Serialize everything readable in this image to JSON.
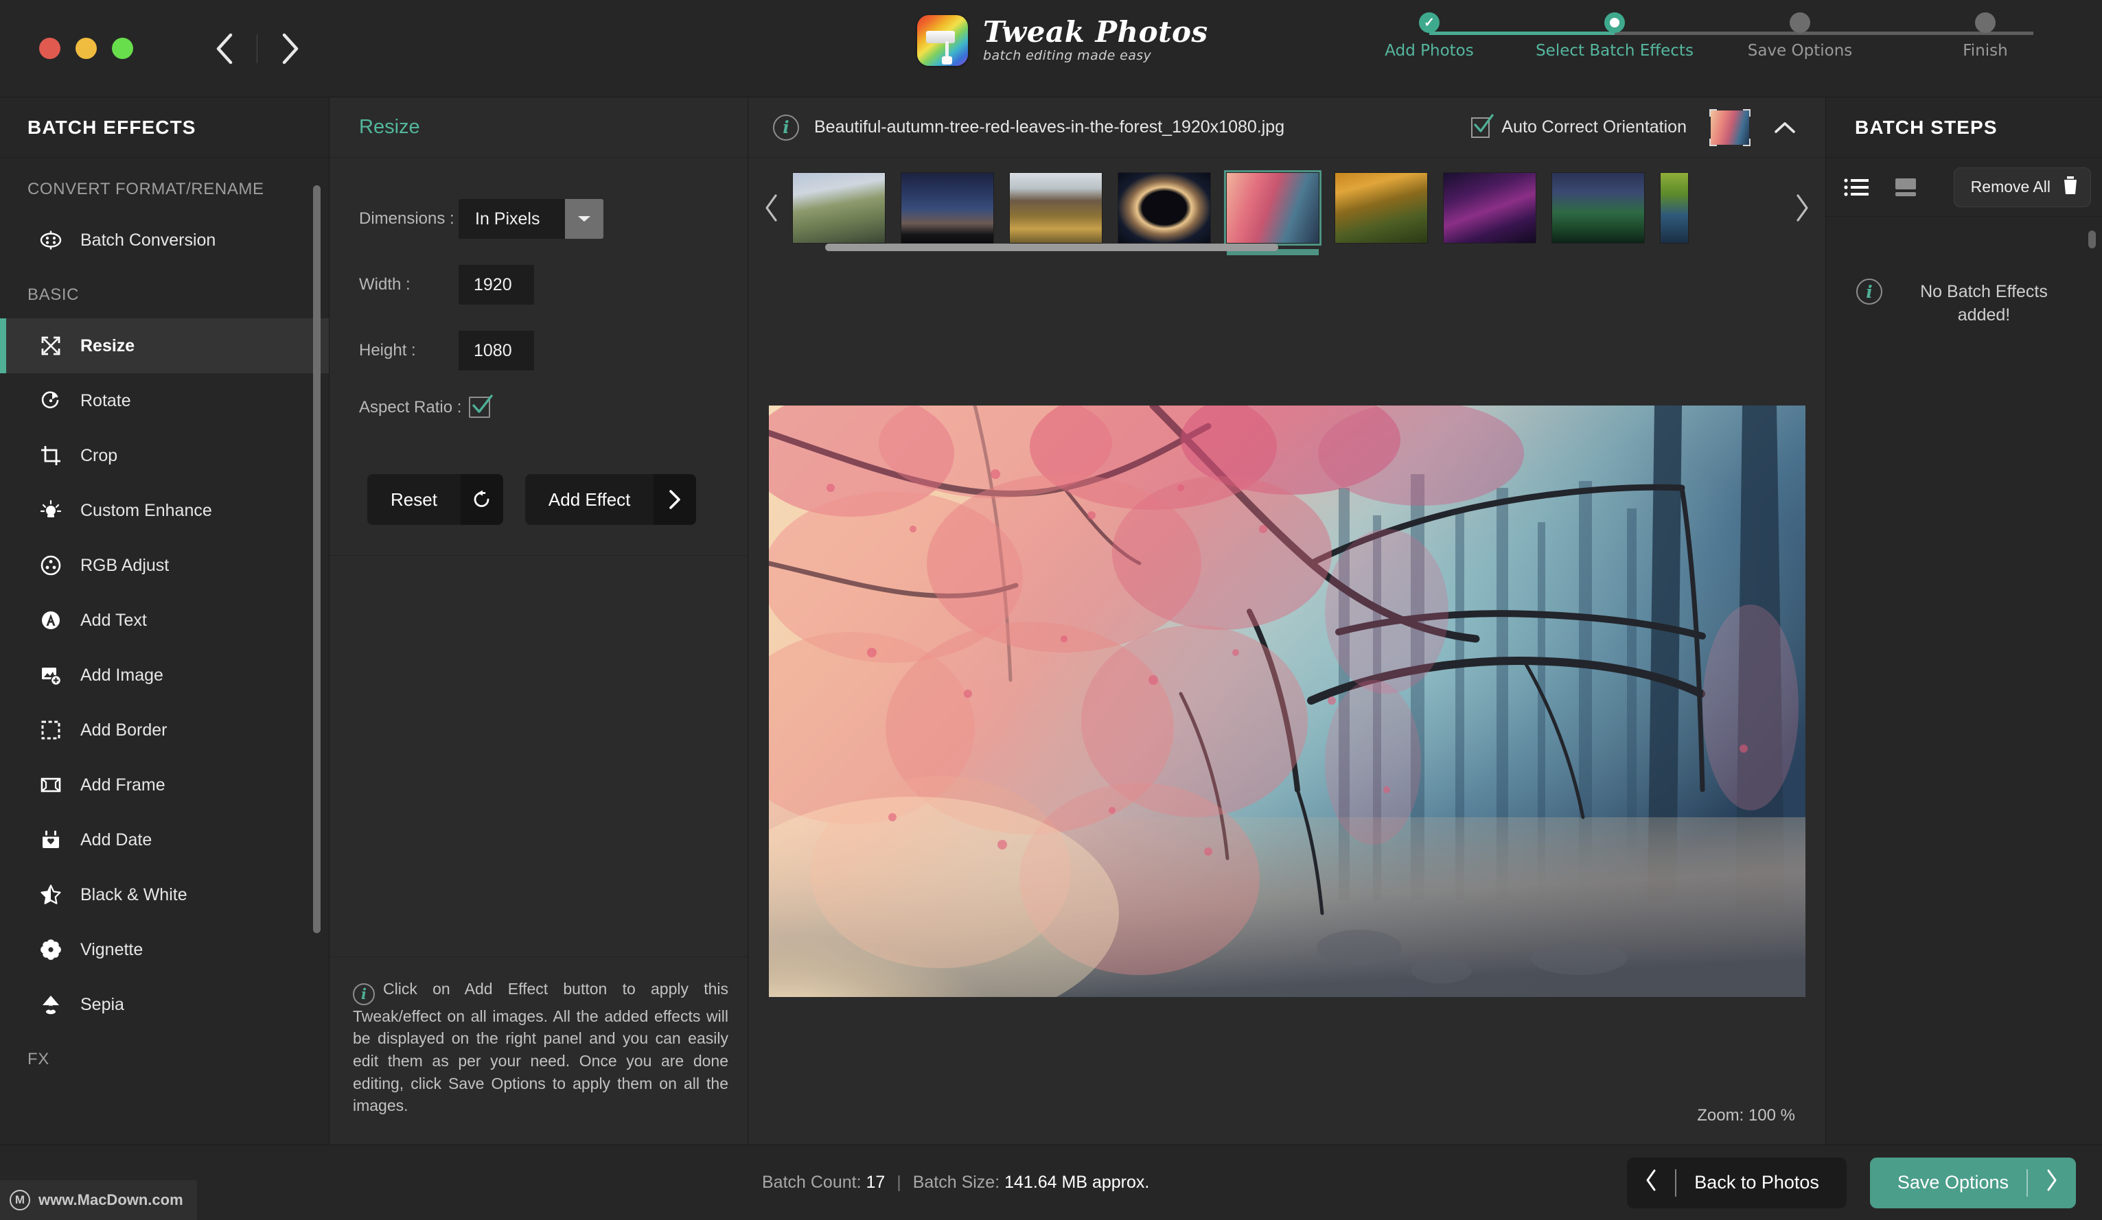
{
  "window": {
    "traffic_lights": [
      "close",
      "minimize",
      "maximize"
    ],
    "nav_back": "back-arrow",
    "nav_forward": "forward-arrow"
  },
  "brand": {
    "title": "Tweak Photos",
    "tagline": "batch editing made easy",
    "logo": "paint-roller-icon"
  },
  "stepper": {
    "steps": [
      {
        "label": "Add Photos",
        "state": "done"
      },
      {
        "label": "Select Batch Effects",
        "state": "current"
      },
      {
        "label": "Save Options",
        "state": "pending"
      },
      {
        "label": "Finish",
        "state": "pending"
      }
    ]
  },
  "sidebar": {
    "title": "BATCH EFFECTS",
    "groups": [
      {
        "label": "CONVERT FORMAT/RENAME",
        "items": [
          {
            "label": "Batch Conversion",
            "icon": "batch-conversion-icon",
            "active": false
          }
        ]
      },
      {
        "label": "BASIC",
        "items": [
          {
            "label": "Resize",
            "icon": "resize-icon",
            "active": true
          },
          {
            "label": "Rotate",
            "icon": "rotate-icon",
            "active": false
          },
          {
            "label": "Crop",
            "icon": "crop-icon",
            "active": false
          },
          {
            "label": "Custom Enhance",
            "icon": "lightbulb-icon",
            "active": false
          },
          {
            "label": "RGB Adjust",
            "icon": "rgb-adjust-icon",
            "active": false
          },
          {
            "label": "Add Text",
            "icon": "add-text-icon",
            "active": false
          },
          {
            "label": "Add Image",
            "icon": "add-image-icon",
            "active": false
          },
          {
            "label": "Add Border",
            "icon": "add-border-icon",
            "active": false
          },
          {
            "label": "Add Frame",
            "icon": "add-frame-icon",
            "active": false
          },
          {
            "label": "Add Date",
            "icon": "calendar-icon",
            "active": false
          },
          {
            "label": "Black & White",
            "icon": "star-half-icon",
            "active": false
          },
          {
            "label": "Vignette",
            "icon": "flower-icon",
            "active": false
          },
          {
            "label": "Sepia",
            "icon": "lamp-icon",
            "active": false
          }
        ]
      },
      {
        "label": "FX",
        "items": []
      }
    ]
  },
  "effect_panel": {
    "title": "Resize",
    "fields": {
      "dimensions_label": "Dimensions :",
      "dimensions_value": "In Pixels",
      "width_label": "Width :",
      "width_value": "1920",
      "height_label": "Height :",
      "height_value": "1080",
      "aspect_label": "Aspect Ratio :",
      "aspect_checked": true
    },
    "reset_label": "Reset",
    "add_effect_label": "Add Effect",
    "note": "Click on Add Effect button to apply this Tweak/effect on all images. All the added effects will be displayed on the right panel and you can easily edit them as per your need. Once you are done editing, click Save Options to apply them on all the images."
  },
  "main": {
    "filename": "Beautiful-autumn-tree-red-leaves-in-the-forest_1920x1080.jpg",
    "auto_correct_label": "Auto Correct Orientation",
    "auto_correct_checked": true,
    "collapse_icon": "chevron-up-icon",
    "zoom_label": "Zoom: 100 %",
    "filmstrip": {
      "prev_icon": "chevron-left-icon",
      "next_icon": "chevron-right-icon",
      "selected_index": 4,
      "thumbs": [
        {
          "name": "thumb-sunset-tree",
          "grad": "linear-gradient(170deg,#b9c6d8 0%,#cfd6de 26%,#8d9a6d 46%,#6f7f54 66%,#515f43 86%,#3b4533 100%)"
        },
        {
          "name": "thumb-night-sky",
          "grad": "linear-gradient(180deg,#1c2340 0%,#2b3b66 32%,#3a4d7a 52%,#6b5a55 72%,#161618 88%,#0c0c10 100%)"
        },
        {
          "name": "thumb-canyon-aspen",
          "grad": "linear-gradient(180deg,#d8dde2 0%,#b9c2c6 22%,#6d5a46 40%,#8d7336 62%,#c7a04a 80%,#6f5e2d 100%)"
        },
        {
          "name": "thumb-eclipse",
          "grad": "radial-gradient(ellipse at 50% 50%, #0a0a10 0%, #0a0a10 36%, #e9c48c 44%, #8a6a4a 56%, #141b2d 74%, #0a0d18 100%)"
        },
        {
          "name": "thumb-pink-forest",
          "grad": "linear-gradient(110deg,#f1b39c 0%,#e2717f 28%,#c85670 46%,#4d7a92 70%,#27384f 100%)"
        },
        {
          "name": "thumb-golden-bokeh",
          "grad": "linear-gradient(165deg,#c8871f 0%,#e0a53a 22%,#8a6a1d 44%,#4f5f24 68%,#2a3a16 100%)"
        },
        {
          "name": "thumb-purple-nebula",
          "grad": "linear-gradient(160deg,#1a1030 0%,#4b1b5e 30%,#8b2f86 52%,#3a1550 74%,#120a20 100%)"
        },
        {
          "name": "thumb-green-aurora",
          "grad": "linear-gradient(180deg,#2a3256 0%,#3b4a72 28%,#2f6a45 56%,#1d4a2c 78%,#0e2418 100%)"
        },
        {
          "name": "thumb-partial-next",
          "grad": "linear-gradient(180deg,#8fae3a 0%,#5d8b2a 30%,#2f5a7a 60%,#1b2f45 100%)"
        }
      ]
    }
  },
  "right_panel": {
    "title": "BATCH STEPS",
    "list_view_icon": "list-view-icon",
    "grid_view_icon": "card-view-icon",
    "remove_all_label": "Remove  All",
    "trash_icon": "trash-icon",
    "empty_message": "No Batch\nEffects added!"
  },
  "footer": {
    "batch_count_label": "Batch Count:",
    "batch_count_value": "17",
    "batch_size_label": "Batch Size:",
    "batch_size_value": "141.64 MB approx.",
    "back_label": "Back to Photos",
    "save_label": "Save Options"
  },
  "watermark": {
    "text": "www.MacDown.com",
    "mark": "M"
  },
  "colors": {
    "accent": "#4fb096",
    "accent_button": "#4b9e8a",
    "panel_bg": "#262626",
    "effect_bg": "#2b2b2b",
    "dark_button": "#1b1b1b",
    "traffic_red": "#e05a50",
    "traffic_yellow": "#f0bc3f",
    "traffic_green": "#68de4c"
  }
}
